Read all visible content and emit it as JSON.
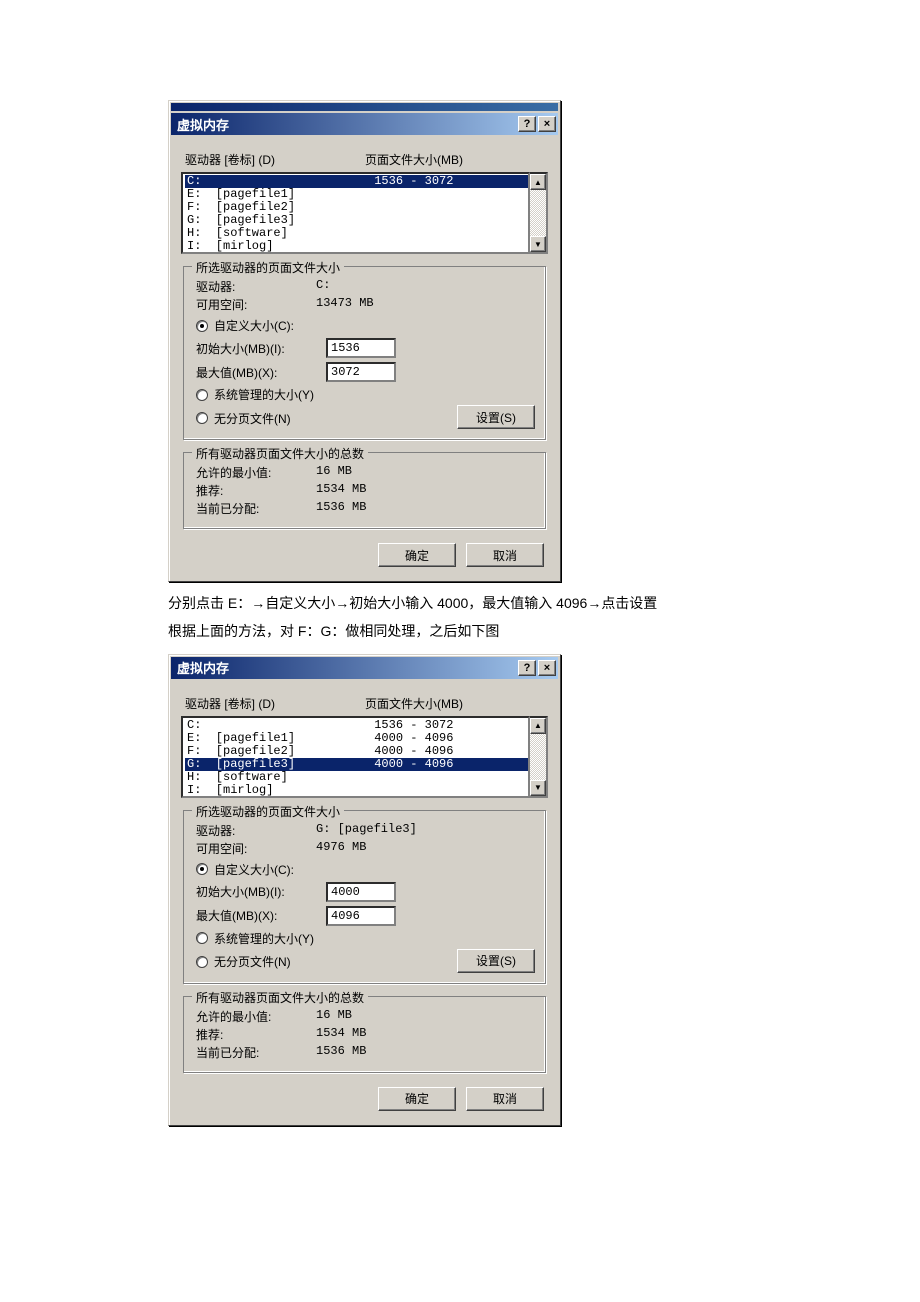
{
  "dialog_title": "虚拟内存",
  "help_glyph": "?",
  "close_glyph": "×",
  "columns": {
    "drive": "驱动器 [卷标] (D)",
    "pagefile": "页面文件大小(MB)"
  },
  "dlg1": {
    "drives": [
      {
        "drive": "C:",
        "label": "",
        "size": "1536 - 3072",
        "selected": true
      },
      {
        "drive": "E:",
        "label": "[pagefile1]",
        "size": "",
        "selected": false
      },
      {
        "drive": "F:",
        "label": "[pagefile2]",
        "size": "",
        "selected": false
      },
      {
        "drive": "G:",
        "label": "[pagefile3]",
        "size": "",
        "selected": false
      },
      {
        "drive": "H:",
        "label": "[software]",
        "size": "",
        "selected": false
      },
      {
        "drive": "I:",
        "label": "[mirlog]",
        "size": "",
        "selected": false
      }
    ],
    "selected": {
      "legend": "所选驱动器的页面文件大小",
      "drive_label": "驱动器:",
      "drive_value": "C:",
      "space_label": "可用空间:",
      "space_value": "13473 MB",
      "custom_label": "自定义大小(C):",
      "init_label": "初始大小(MB)(I):",
      "init_value": "1536",
      "max_label": "最大值(MB)(X):",
      "max_value": "3072",
      "system_label": "系统管理的大小(Y)",
      "none_label": "无分页文件(N)",
      "set_button": "设置(S)"
    },
    "totals": {
      "legend": "所有驱动器页面文件大小的总数",
      "min_label": "允许的最小值:",
      "min_value": "16 MB",
      "rec_label": "推荐:",
      "rec_value": "1534 MB",
      "cur_label": "当前已分配:",
      "cur_value": "1536 MB"
    },
    "ok": "确定",
    "cancel": "取消"
  },
  "para1_a": "分别点击 E：",
  "para1_b": "自定义大小",
  "para1_c": "初始大小输入 4000，最大值输入 4096",
  "para1_d": "点击设置",
  "para2": "根据上面的方法，对 F：G：做相同处理，之后如下图",
  "dlg2": {
    "drives": [
      {
        "drive": "C:",
        "label": "",
        "size": "1536 - 3072",
        "selected": false
      },
      {
        "drive": "E:",
        "label": "[pagefile1]",
        "size": "4000 - 4096",
        "selected": false
      },
      {
        "drive": "F:",
        "label": "[pagefile2]",
        "size": "4000 - 4096",
        "selected": false
      },
      {
        "drive": "G:",
        "label": "[pagefile3]",
        "size": "4000 - 4096",
        "selected": true
      },
      {
        "drive": "H:",
        "label": "[software]",
        "size": "",
        "selected": false
      },
      {
        "drive": "I:",
        "label": "[mirlog]",
        "size": "",
        "selected": false
      }
    ],
    "selected": {
      "legend": "所选驱动器的页面文件大小",
      "drive_label": "驱动器:",
      "drive_value": "G:  [pagefile3]",
      "space_label": "可用空间:",
      "space_value": "4976 MB",
      "custom_label": "自定义大小(C):",
      "init_label": "初始大小(MB)(I):",
      "init_value": "4000",
      "max_label": "最大值(MB)(X):",
      "max_value": "4096",
      "system_label": "系统管理的大小(Y)",
      "none_label": "无分页文件(N)",
      "set_button": "设置(S)"
    },
    "totals": {
      "legend": "所有驱动器页面文件大小的总数",
      "min_label": "允许的最小值:",
      "min_value": "16 MB",
      "rec_label": "推荐:",
      "rec_value": "1534 MB",
      "cur_label": "当前已分配:",
      "cur_value": "1536 MB"
    },
    "ok": "确定",
    "cancel": "取消"
  }
}
